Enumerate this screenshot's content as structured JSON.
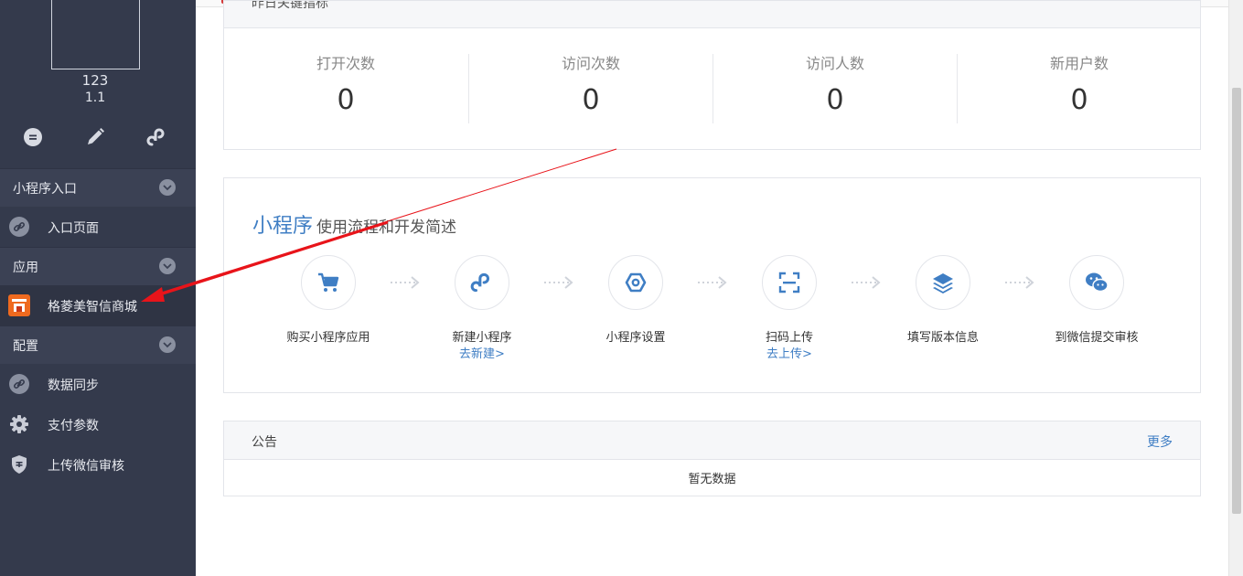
{
  "colors": {
    "sidebar_bg": "#343a4c",
    "accent_blue": "#3f7ec4",
    "annotation_red": "#e8141a"
  },
  "sidebar": {
    "app_name": "123",
    "app_version": "1.1",
    "quick_icons": [
      "chat-bubble-icon",
      "pencil-icon",
      "mini-program-icon"
    ],
    "sections": [
      {
        "label": "小程序入口",
        "items": [
          {
            "label": "入口页面",
            "icon": "link-icon"
          }
        ]
      },
      {
        "label": "应用",
        "items": [
          {
            "label": "格菱美智信商城",
            "icon": "store-app-icon"
          }
        ]
      },
      {
        "label": "配置",
        "items": [
          {
            "label": "数据同步",
            "icon": "link-icon"
          },
          {
            "label": "支付参数",
            "icon": "gear-icon"
          },
          {
            "label": "上传微信审核",
            "icon": "shield-icon"
          }
        ]
      }
    ]
  },
  "kpis": {
    "title": "昨日关键指标",
    "items": [
      {
        "label": "打开次数",
        "value": "0"
      },
      {
        "label": "访问次数",
        "value": "0"
      },
      {
        "label": "访问人数",
        "value": "0"
      },
      {
        "label": "新用户数",
        "value": "0"
      }
    ]
  },
  "flow": {
    "title": "小程序",
    "subtitle": "使用流程和开发简述",
    "steps": [
      {
        "name": "购买小程序应用",
        "link": "",
        "icon": "cart-icon"
      },
      {
        "name": "新建小程序",
        "link": "去新建>",
        "icon": "mini-program-icon"
      },
      {
        "name": "小程序设置",
        "link": "",
        "icon": "hexagon-settings-icon"
      },
      {
        "name": "扫码上传",
        "link": "去上传>",
        "icon": "scan-icon"
      },
      {
        "name": "填写版本信息",
        "link": "",
        "icon": "layers-icon"
      },
      {
        "name": "到微信提交审核",
        "link": "",
        "icon": "wechat-icon"
      }
    ]
  },
  "notice": {
    "title": "公告",
    "more": "更多",
    "empty": "暂无数据"
  }
}
